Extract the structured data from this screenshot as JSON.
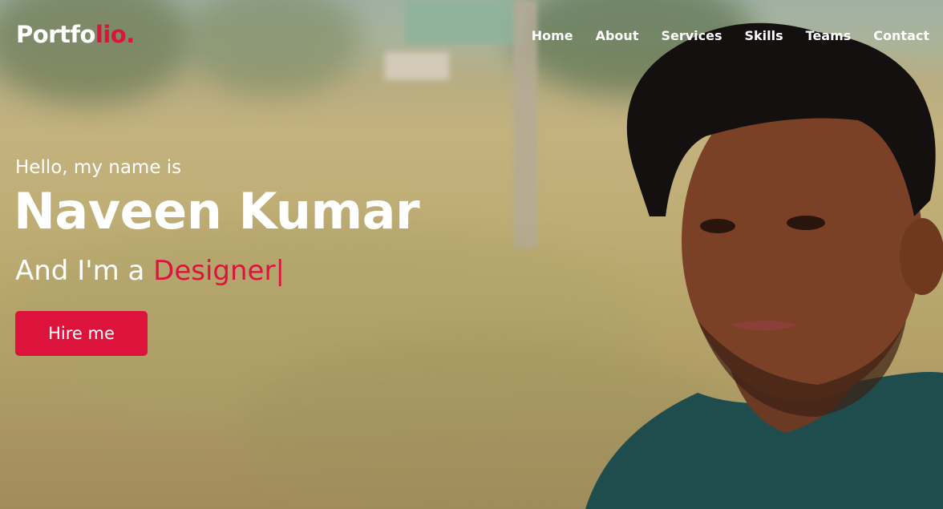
{
  "logo": {
    "text": "Portfo",
    "accent": "lio."
  },
  "nav": {
    "items": [
      {
        "label": "Home"
      },
      {
        "label": "About"
      },
      {
        "label": "Services"
      },
      {
        "label": "Skills"
      },
      {
        "label": "Teams"
      },
      {
        "label": "Contact"
      }
    ]
  },
  "hero": {
    "greeting": "Hello, my name is",
    "name": "Naveen Kumar",
    "role_prefix": "And I'm a ",
    "role": "Designer",
    "cursor": "|",
    "cta": "Hire me"
  },
  "colors": {
    "accent": "#dc143c",
    "text": "#ffffff"
  }
}
